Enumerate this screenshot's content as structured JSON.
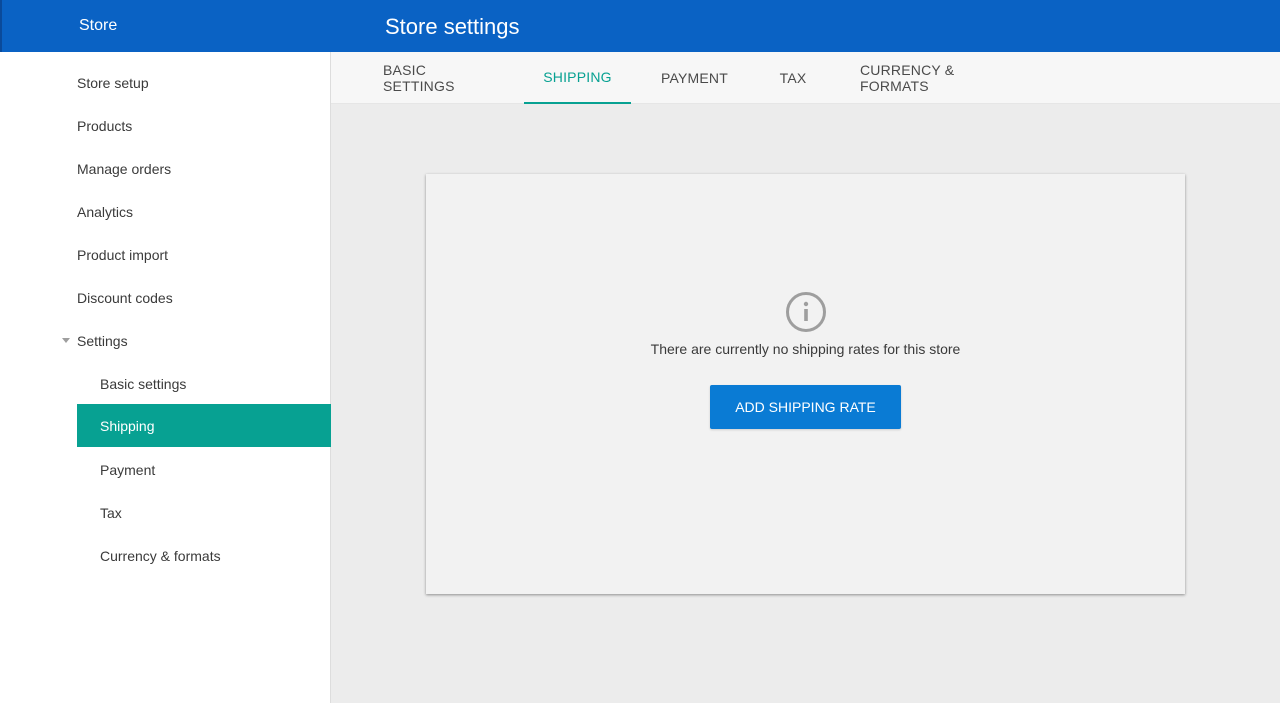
{
  "header": {
    "app_title": "Store",
    "page_title": "Store settings"
  },
  "sidebar": {
    "items": [
      {
        "label": "Store setup"
      },
      {
        "label": "Products"
      },
      {
        "label": "Manage orders"
      },
      {
        "label": "Analytics"
      },
      {
        "label": "Product import"
      },
      {
        "label": "Discount codes"
      },
      {
        "label": "Settings",
        "expanded": true
      }
    ],
    "sub_items": [
      {
        "label": "Basic settings"
      },
      {
        "label": "Shipping",
        "active": true
      },
      {
        "label": "Payment"
      },
      {
        "label": "Tax"
      },
      {
        "label": "Currency & formats"
      }
    ]
  },
  "tabs": [
    {
      "label": "BASIC SETTINGS"
    },
    {
      "label": "SHIPPING",
      "active": true
    },
    {
      "label": "PAYMENT"
    },
    {
      "label": "TAX"
    },
    {
      "label": "CURRENCY & FORMATS"
    }
  ],
  "empty_state": {
    "icon": "info-icon",
    "message": "There are currently no shipping rates for this store",
    "button_label": "ADD SHIPPING RATE"
  },
  "colors": {
    "header": "#0a62c4",
    "accent": "#07a192",
    "button": "#0a7bd4"
  }
}
